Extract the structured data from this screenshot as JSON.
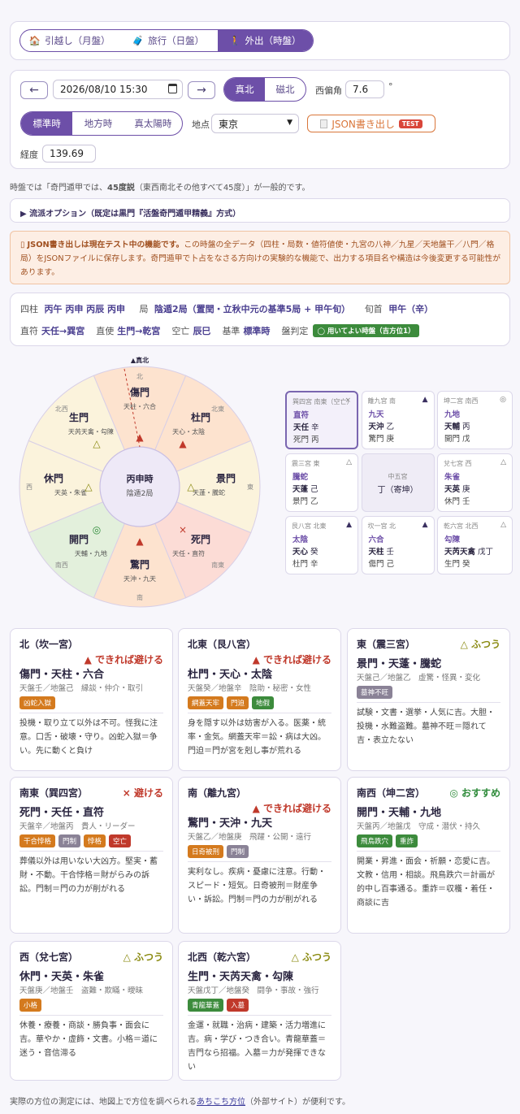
{
  "modes": {
    "items": [
      {
        "icon": "🏠",
        "label": "引越し（月盤）"
      },
      {
        "icon": "🧳",
        "label": "旅行（日盤）"
      },
      {
        "icon": "🚶",
        "label": "外出（時盤）"
      }
    ]
  },
  "controls": {
    "prev": "←",
    "next": "→",
    "datetime": "2026/08/10 15:30",
    "north_true": "真北",
    "north_mag": "磁北",
    "decl_label": "西偏角",
    "decl_value": "7.6",
    "decl_unit": "°",
    "time_modes": [
      "標準時",
      "地方時",
      "真太陽時"
    ],
    "place_label": "地点",
    "place_value": "東京",
    "json_btn": "JSON書き出し",
    "test_badge": "TEST",
    "lon_label": "経度",
    "lon_value": "139.69"
  },
  "note1": {
    "a": "時盤では「奇門遁甲では、",
    "b": "45度説",
    "c": "（東西南北その他すべて45度）」が一般的です。"
  },
  "school": "▶ 流派オプション（既定は黒門『活盤奇門遁甲精義』方式）",
  "warning": {
    "bold": "JSON書き出しは現在テスト中の機能です。",
    "rest": "この時盤の全データ（四柱・局数・値符値使・九宮の八神／九星／天地盤干／八門／格局）をJSONファイルに保存します。奇門遁甲で卜占をなさる方向けの実験的な機能で、出力する項目名や構造は今後変更する可能性があります。"
  },
  "info": {
    "pillars_label": "四柱",
    "pillars": "丙午 丙申 丙辰 丙申",
    "kyoku_label": "局",
    "kyoku": "陰遁2局（置閏・立秋中元の基準5局 + 甲午旬）",
    "junshu_label": "旬首",
    "junshu": "甲午（辛）",
    "chokufu_label": "直符",
    "chokufu": "天任→巽宮",
    "chokushi_label": "直使",
    "chokushi": "生門→乾宮",
    "kubo_label": "空亡",
    "kubo": "辰巳",
    "kijun_label": "基準",
    "kijun": "標準時",
    "hantei_label": "盤判定",
    "hantei": "◯ 用いてよい時盤（吉方位1）"
  },
  "wheel": {
    "north_mark": "▲真北",
    "center1": "丙申時",
    "center2": "陰遁2局",
    "dirs": [
      "北",
      "北東",
      "東",
      "南東",
      "南",
      "南西",
      "西",
      "北西"
    ],
    "sectors": [
      {
        "gate": "傷門",
        "sub": "天柱・六合",
        "mark": "▲"
      },
      {
        "gate": "杜門",
        "sub": "天心・太陰",
        "mark": "▲"
      },
      {
        "gate": "景門",
        "sub": "天蓬・騰蛇",
        "mark": "△"
      },
      {
        "gate": "死門",
        "sub": "天任・直符",
        "mark": "×"
      },
      {
        "gate": "驚門",
        "sub": "天沖・九天",
        "mark": "▲"
      },
      {
        "gate": "開門",
        "sub": "天輔・九地",
        "mark": "◎"
      },
      {
        "gate": "休門",
        "sub": "天英・朱雀",
        "mark": "△"
      },
      {
        "gate": "生門",
        "sub": "天芮天禽・勾陳",
        "mark": "△"
      }
    ]
  },
  "grid": [
    {
      "hd": "巽四宮 南東（空亡）",
      "mk": "×",
      "god": "直符",
      "star": "天任",
      "s_stem": "辛",
      "gate": "死門",
      "g_stem": "丙"
    },
    {
      "hd": "離九宮 南",
      "mk": "▲",
      "god": "九天",
      "star": "天沖",
      "s_stem": "乙",
      "gate": "驚門",
      "g_stem": "庚"
    },
    {
      "hd": "坤二宮 南西",
      "mk": "◎",
      "god": "九地",
      "star": "天輔",
      "s_stem": "丙",
      "gate": "開門",
      "g_stem": "戊"
    },
    {
      "hd": "震三宮 東",
      "mk": "△",
      "god": "騰蛇",
      "star": "天蓬",
      "s_stem": "己",
      "gate": "景門",
      "g_stem": "乙"
    },
    {
      "hd": "中五宮",
      "mk": "",
      "god": "",
      "star": "丁（寄坤）",
      "s_stem": "",
      "gate": "",
      "g_stem": ""
    },
    {
      "hd": "兌七宮 西",
      "mk": "△",
      "god": "朱雀",
      "star": "天英",
      "s_stem": "庚",
      "gate": "休門",
      "g_stem": "壬"
    },
    {
      "hd": "艮八宮 北東",
      "mk": "▲",
      "god": "太陰",
      "star": "天心",
      "s_stem": "癸",
      "gate": "杜門",
      "g_stem": "辛"
    },
    {
      "hd": "坎一宮 北",
      "mk": "▲",
      "god": "六合",
      "star": "天柱",
      "s_stem": "壬",
      "gate": "傷門",
      "g_stem": "己"
    },
    {
      "hd": "乾六宮 北西",
      "mk": "△",
      "god": "勾陳",
      "star": "天芮天禽",
      "s_stem": "戊丁",
      "gate": "生門",
      "g_stem": "癸"
    }
  ],
  "dirs": [
    {
      "title": "北（坎一宮）",
      "verdict": "▲ できれば避ける",
      "main": "傷門・天柱・六合",
      "sub": "天盤壬／地盤己　縁談・仲介・取引",
      "tags": [
        {
          "t": "凶蛇入獄",
          "c": "#d47a1e"
        }
      ],
      "desc": "投機・取り立て以外は不可。怪我に注意。口舌・破壊・守り。凶蛇入獄＝争い。先に動くと負け"
    },
    {
      "title": "北東（艮八宮）",
      "verdict": "▲ できれば避ける",
      "main": "杜門・天心・太陰",
      "sub": "天盤癸／地盤辛　陰助・秘密・女性",
      "tags": [
        {
          "t": "網蓋天牢",
          "c": "#d47a1e"
        },
        {
          "t": "門迫",
          "c": "#d47a1e"
        },
        {
          "t": "地假",
          "c": "#3c8b3c"
        }
      ],
      "desc": "身を隠す以外は妨害が入る。医薬・統率・金気。網蓋天牢＝訟・病は大凶。門迫＝門が宮を剋し事が荒れる"
    },
    {
      "title": "東（震三宮）",
      "verdict": "△ ふつう",
      "main": "景門・天蓬・騰蛇",
      "sub": "天盤己／地盤乙　虚驚・怪異・変化",
      "tags": [
        {
          "t": "墓神不旺",
          "c": "#8a8296"
        }
      ],
      "desc": "試験・文書・選挙・人気に吉。大胆・投機・水難盗難。墓神不旺＝隠れて吉・表立たない"
    },
    {
      "title": "南東（巽四宮）",
      "verdict": "× 避ける",
      "main": "死門・天任・直符",
      "sub": "天盤辛／地盤丙　貴人・リーダー",
      "tags": [
        {
          "t": "干合悖格",
          "c": "#d47a1e"
        },
        {
          "t": "門制",
          "c": "#8a8296"
        },
        {
          "t": "悖格",
          "c": "#d47a1e"
        },
        {
          "t": "空亡",
          "c": "#c0392b"
        }
      ],
      "desc": "葬儀以外は用いない大凶方。堅実・蓄財・不動。干合悖格＝財がらみの訴訟。門制＝門の力が削がれる"
    },
    {
      "title": "南（離九宮）",
      "verdict": "▲ できれば避ける",
      "main": "驚門・天沖・九天",
      "sub": "天盤乙／地盤庚　飛躍・公開・遠行",
      "tags": [
        {
          "t": "日奇被刑",
          "c": "#d47a1e"
        },
        {
          "t": "門制",
          "c": "#8a8296"
        }
      ],
      "desc": "実利なし。疾病・憂慮に注意。行動・スピード・短気。日奇被刑＝財産争い・訴訟。門制＝門の力が削がれる"
    },
    {
      "title": "南西（坤二宮）",
      "verdict": "◎ おすすめ",
      "main": "開門・天輔・九地",
      "sub": "天盤丙／地盤戊　守成・潜伏・持久",
      "tags": [
        {
          "t": "飛鳥跌穴",
          "c": "#3c8b3c"
        },
        {
          "t": "重詐",
          "c": "#3c8b3c"
        }
      ],
      "desc": "開業・昇進・面会・祈願・恋愛に吉。文教・信用・相談。飛鳥跌穴＝計画が的中し百事通る。重詐＝収穫・着任・商談に吉"
    },
    {
      "title": "西（兌七宮）",
      "verdict": "△ ふつう",
      "main": "休門・天英・朱雀",
      "sub": "天盤庚／地盤壬　盗難・欺瞞・曖昧",
      "tags": [
        {
          "t": "小格",
          "c": "#d47a1e"
        }
      ],
      "desc": "休養・療養・商談・勝負事・面会に吉。華やか・虚飾・文書。小格＝道に迷う・音信滞る"
    },
    {
      "title": "北西（乾六宮）",
      "verdict": "△ ふつう",
      "main": "生門・天芮天禽・勾陳",
      "sub": "天盤戊丁／地盤癸　闘争・事故・強行",
      "tags": [
        {
          "t": "青龍華蓋",
          "c": "#3c8b3c"
        },
        {
          "t": "入墓",
          "c": "#c0392b"
        }
      ],
      "desc": "金運・就職・治病・建築・活力増進に吉。病・学び・つき合い。青龍華蓋＝吉門なら招福。入墓＝力が発揮できない"
    }
  ],
  "footer": {
    "a": "実際の方位の測定には、地図上で方位を調べられる",
    "link": "あちこち方位",
    "b": "（外部サイト）が便利です。"
  }
}
